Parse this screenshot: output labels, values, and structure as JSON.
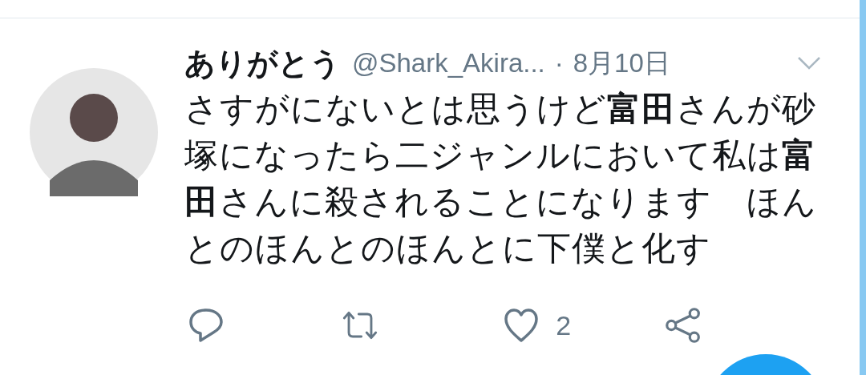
{
  "tweet": {
    "display_name": "ありがとう",
    "handle": "@Shark_Akira...",
    "separator": "·",
    "date": "8月10日",
    "text": "さすがにないとは思うけど**富田**さんが砂塚になったら二ジャンルにおいて私は**富田**さんに殺されることになります　ほんとのほんとのほんとに下僕と化す",
    "actions": [
      {
        "kind": "reply"
      },
      {
        "kind": "retweet"
      },
      {
        "kind": "like",
        "count": "2"
      },
      {
        "kind": "share"
      }
    ]
  }
}
